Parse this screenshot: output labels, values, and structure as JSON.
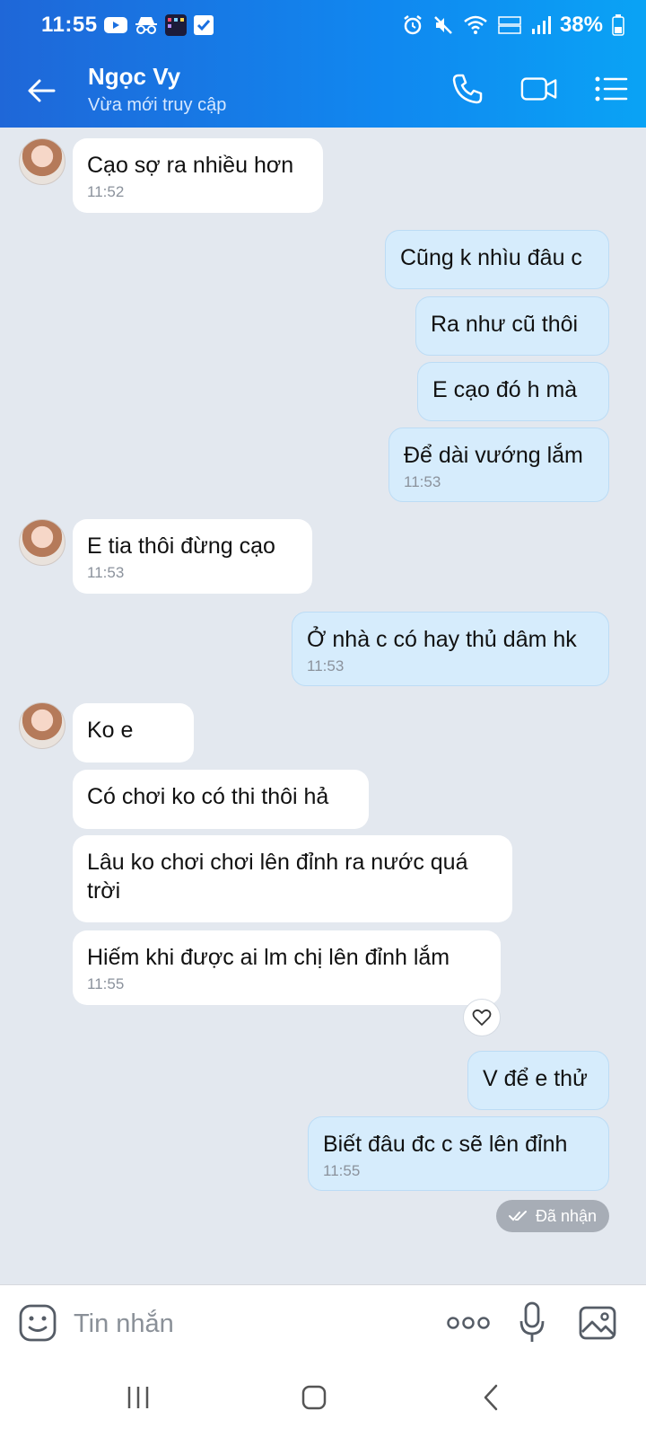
{
  "status_bar": {
    "time": "11:55",
    "battery": "38%"
  },
  "header": {
    "contact_name": "Ngọc Vy",
    "contact_status": "Vừa mới truy cập"
  },
  "messages": [
    {
      "side": "in",
      "text": "Cạo sợ ra nhiều hơn",
      "time": "11:52"
    },
    {
      "side": "out",
      "text": "Cũng k nhìu đâu c",
      "time": ""
    },
    {
      "side": "out",
      "text": "Ra như cũ thôi",
      "time": ""
    },
    {
      "side": "out",
      "text": "E cạo đó h mà",
      "time": ""
    },
    {
      "side": "out",
      "text": "Để dài vướng lắm",
      "time": "11:53"
    },
    {
      "side": "in",
      "text": "E tia thôi đừng cạo",
      "time": "11:53"
    },
    {
      "side": "out",
      "text": "Ở nhà c có hay thủ dâm hk",
      "time": "11:53"
    },
    {
      "side": "in",
      "text": "Ko e",
      "time": ""
    },
    {
      "side": "in",
      "text": "Có chơi ko có thi thôi hả",
      "time": ""
    },
    {
      "side": "in",
      "text": "Lâu ko chơi chơi lên đỉnh ra nước quá trời",
      "time": ""
    },
    {
      "side": "in",
      "text": "Hiếm khi được ai lm chị lên đỉnh lắm",
      "time": "11:55"
    },
    {
      "side": "out",
      "text": "V để e thử",
      "time": ""
    },
    {
      "side": "out",
      "text": "Biết đâu đc c sẽ lên đỉnh",
      "time": "11:55"
    }
  ],
  "delivery_status": "Đã nhận",
  "input": {
    "placeholder": "Tin nhắn"
  },
  "colors": {
    "header_start": "#1f67d8",
    "header_end": "#0aa3f5",
    "chat_bg": "#e3e8ef",
    "outgoing_bubble": "#d6ecfc",
    "incoming_bubble": "#ffffff"
  }
}
